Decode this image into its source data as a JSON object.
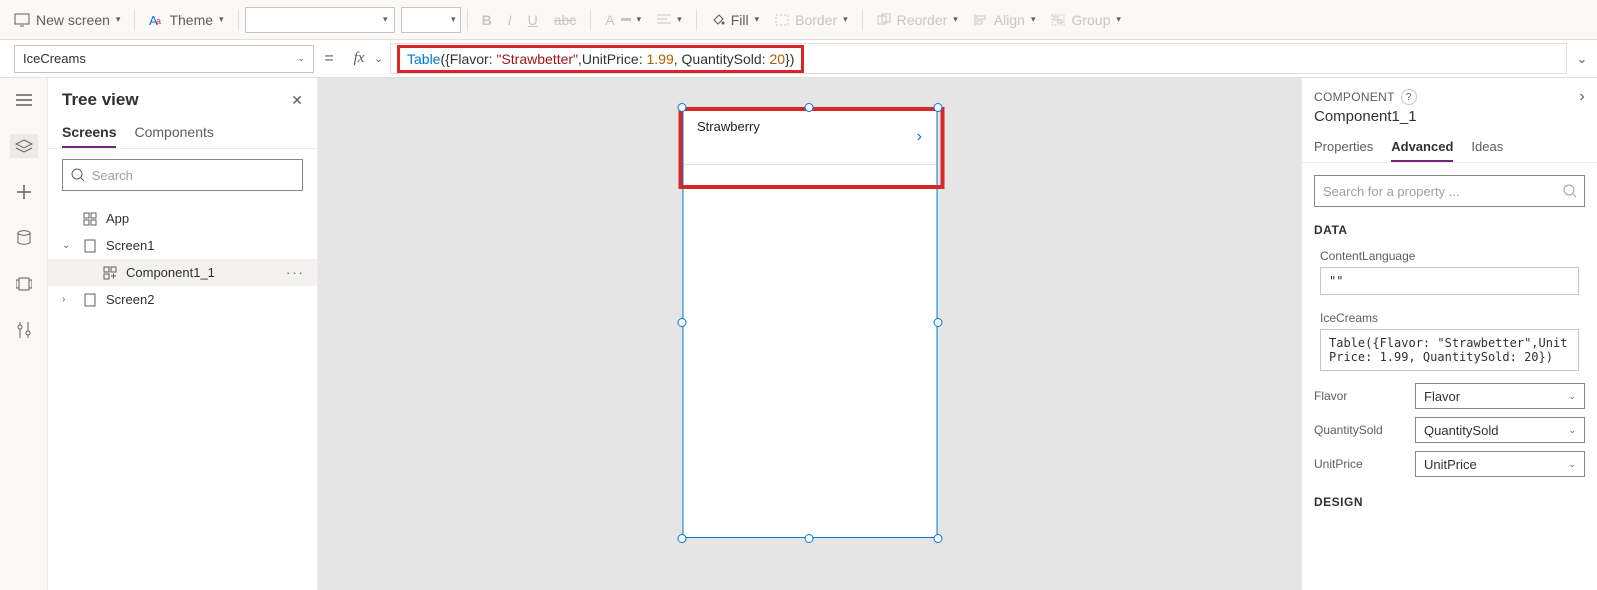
{
  "toolbar": {
    "new_screen": "New screen",
    "theme": "Theme",
    "fill": "Fill",
    "border": "Border",
    "reorder": "Reorder",
    "align": "Align",
    "group": "Group"
  },
  "formula": {
    "property": "IceCreams",
    "fn": "Table",
    "body_raw": "({Flavor: ",
    "str": "\"Strawbetter\"",
    "mid": ",UnitPrice: ",
    "num1": "1.99",
    "mid2": ", QuantitySold: ",
    "num2": "20",
    "tail": "})"
  },
  "tree": {
    "title": "Tree view",
    "tabs": {
      "screens": "Screens",
      "components": "Components"
    },
    "search_placeholder": "Search",
    "items": {
      "app": "App",
      "screen1": "Screen1",
      "component": "Component1_1",
      "screen2": "Screen2"
    }
  },
  "canvas": {
    "row_text": "Strawberry"
  },
  "rpanel": {
    "header": "COMPONENT",
    "name": "Component1_1",
    "tabs": {
      "properties": "Properties",
      "advanced": "Advanced",
      "ideas": "Ideas"
    },
    "search_placeholder": "Search for a property ...",
    "section_data": "DATA",
    "content_language_label": "ContentLanguage",
    "content_language_value": "\"\"",
    "icecreams_label": "IceCreams",
    "icecreams_value": "Table({Flavor: \"Strawbetter\",UnitPrice: 1.99, QuantitySold: 20})",
    "flavor_label": "Flavor",
    "flavor_value": "Flavor",
    "qty_label": "QuantitySold",
    "qty_value": "QuantitySold",
    "price_label": "UnitPrice",
    "price_value": "UnitPrice",
    "section_design": "DESIGN"
  }
}
